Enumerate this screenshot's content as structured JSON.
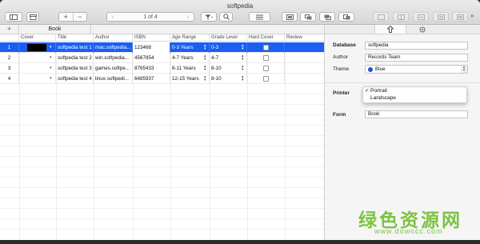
{
  "window": {
    "title": "softpedia"
  },
  "toolbar": {
    "pager": {
      "text": "1 of 4",
      "prev_icon": "chevron-left-icon",
      "next_icon": "chevron-right-icon"
    },
    "add_label": "+",
    "remove_label": "−"
  },
  "tabs": {
    "add_label": "+",
    "items": [
      {
        "label": "Book"
      }
    ]
  },
  "table": {
    "columns": [
      "",
      "Cover",
      "Title",
      "Author",
      "ISBN",
      "Age Range",
      "Grade Level",
      "Hard Cover",
      "Review"
    ],
    "rows": [
      {
        "num": "1",
        "title": "softpedia test 1",
        "author": "mac.softpedia...",
        "isbn": "123468",
        "age": "0-3 Years",
        "grade": "0-3",
        "selected": true
      },
      {
        "num": "2",
        "title": "softpedia test 2",
        "author": "win.softpedia...",
        "isbn": "4567854",
        "age": "4-7 Years",
        "grade": "4-7",
        "selected": false
      },
      {
        "num": "3",
        "title": "softpedia test 3",
        "author": "games.softpe...",
        "isbn": "8765433",
        "age": "8-11 Years",
        "grade": "8-10",
        "selected": false
      },
      {
        "num": "4",
        "title": "softpedia test 4",
        "author": "linux.softpedi...",
        "isbn": "6485937",
        "age": "12-15 Years",
        "grade": "8-10",
        "selected": false
      }
    ]
  },
  "inspector": {
    "database_label": "Database",
    "database_value": "softpedia",
    "author_label": "Author",
    "author_value": "Records Team",
    "theme_label": "Theme",
    "theme_value": "Blue",
    "printer_label": "Printer",
    "form_label": "Form",
    "form_value": "Book",
    "orientation_menu": [
      "Portrait",
      "Landscape"
    ],
    "orientation_checked": "Portrait"
  },
  "watermark": {
    "text": "绿色资源网",
    "url": "www.downcc.com"
  },
  "colors": {
    "selection": "#1a5ff2",
    "watermark": "#7cc242"
  }
}
